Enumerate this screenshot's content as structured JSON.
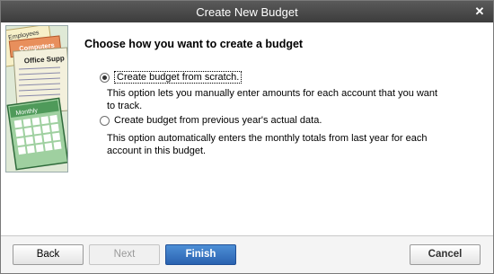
{
  "window": {
    "title": "Create New Budget"
  },
  "art": {
    "labels": [
      "Employees",
      "Computers",
      "Office Supp",
      "Monthly"
    ],
    "icon": "budget-illustration"
  },
  "main": {
    "heading": "Choose how you want to create a budget",
    "options": [
      {
        "label": "Create budget from scratch.",
        "selected": true,
        "description": "This option lets you manually enter amounts for each account that you want to track."
      },
      {
        "label": "Create budget from previous year's actual data.",
        "selected": false,
        "description": "This option automatically enters the monthly totals from last year for each account in this budget."
      }
    ]
  },
  "footer": {
    "back_label": "Back",
    "next_label": "Next",
    "finish_label": "Finish",
    "cancel_label": "Cancel"
  }
}
